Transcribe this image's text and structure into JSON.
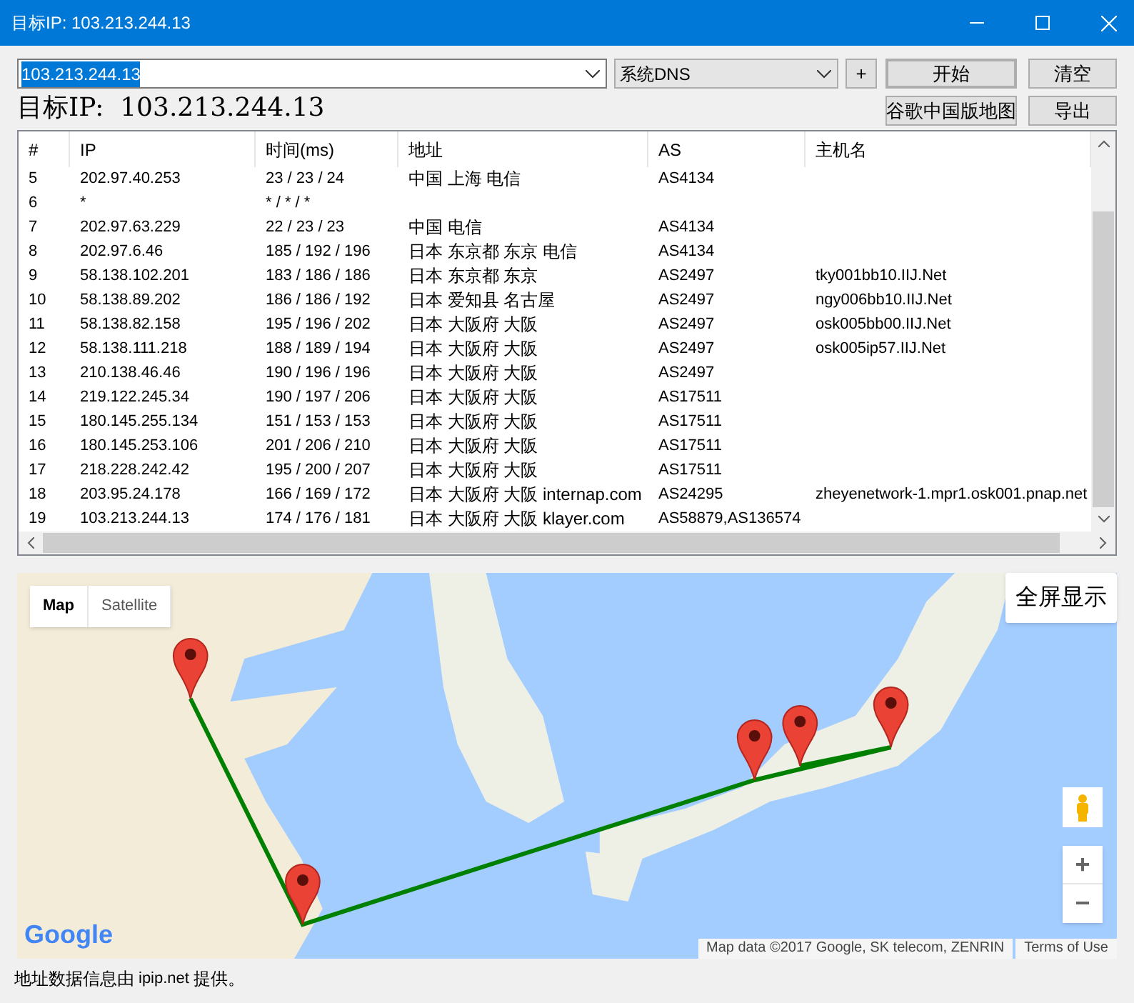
{
  "window": {
    "title": "目标IP: 103.213.244.13"
  },
  "toolbar": {
    "target_input": "103.213.244.13",
    "dns_select": "系统DNS",
    "add_button": "+",
    "start_button": "开始",
    "clear_button": "清空",
    "map_button": "谷歌中国版地图",
    "export_button": "导出"
  },
  "target_label": "目标IP:  103.213.244.13",
  "table": {
    "columns": [
      "#",
      "IP",
      "时间(ms)",
      "地址",
      "AS",
      "主机名"
    ],
    "rows": [
      [
        "5",
        "202.97.40.253",
        "23 / 23 / 24",
        "中国 上海 电信",
        "AS4134",
        ""
      ],
      [
        "6",
        "*",
        "* / * / *",
        "",
        "",
        ""
      ],
      [
        "7",
        "202.97.63.229",
        "22 / 23 / 23",
        "中国 电信",
        "AS4134",
        ""
      ],
      [
        "8",
        "202.97.6.46",
        "185 / 192 / 196",
        "日本 东京都 东京 电信",
        "AS4134",
        ""
      ],
      [
        "9",
        "58.138.102.201",
        "183 / 186 / 186",
        "日本 东京都 东京",
        "AS2497",
        "tky001bb10.IIJ.Net"
      ],
      [
        "10",
        "58.138.89.202",
        "186 / 186 / 192",
        "日本 爱知县 名古屋",
        "AS2497",
        "ngy006bb10.IIJ.Net"
      ],
      [
        "11",
        "58.138.82.158",
        "195 / 196 / 202",
        "日本 大阪府 大阪",
        "AS2497",
        "osk005bb00.IIJ.Net"
      ],
      [
        "12",
        "58.138.111.218",
        "188 / 189 / 194",
        "日本 大阪府 大阪",
        "AS2497",
        "osk005ip57.IIJ.Net"
      ],
      [
        "13",
        "210.138.46.46",
        "190 / 196 / 196",
        "日本 大阪府 大阪",
        "AS2497",
        ""
      ],
      [
        "14",
        "219.122.245.34",
        "190 / 197 / 206",
        "日本 大阪府 大阪",
        "AS17511",
        ""
      ],
      [
        "15",
        "180.145.255.134",
        "151 / 153 / 153",
        "日本 大阪府 大阪",
        "AS17511",
        ""
      ],
      [
        "16",
        "180.145.253.106",
        "201 / 206 / 210",
        "日本 大阪府 大阪",
        "AS17511",
        ""
      ],
      [
        "17",
        "218.228.242.42",
        "195 / 200 / 207",
        "日本 大阪府 大阪",
        "AS17511",
        ""
      ],
      [
        "18",
        "203.95.24.178",
        "166 / 169 / 172",
        "日本 大阪府 大阪 internap.com",
        "AS24295",
        "zheyenetwork-1.mpr1.osk001.pnap.net"
      ],
      [
        "19",
        "103.213.244.13",
        "174 / 176 / 181",
        "日本 大阪府 大阪 klayer.com",
        "AS58879,AS136574",
        ""
      ]
    ]
  },
  "map": {
    "type_buttons": [
      {
        "label": "Map",
        "selected": true
      },
      {
        "label": "Satellite",
        "selected": false
      }
    ],
    "fullscreen_button": "全屏显示",
    "logo": "Google",
    "attribution": "Map data ©2017 Google, SK telecom, ZENRIN",
    "terms": "Terms of Use",
    "zoom_in": "+",
    "zoom_out": "−"
  },
  "footer": {
    "prefix": "地址数据信息由",
    "link": "ipip.net",
    "suffix": "提供。"
  }
}
